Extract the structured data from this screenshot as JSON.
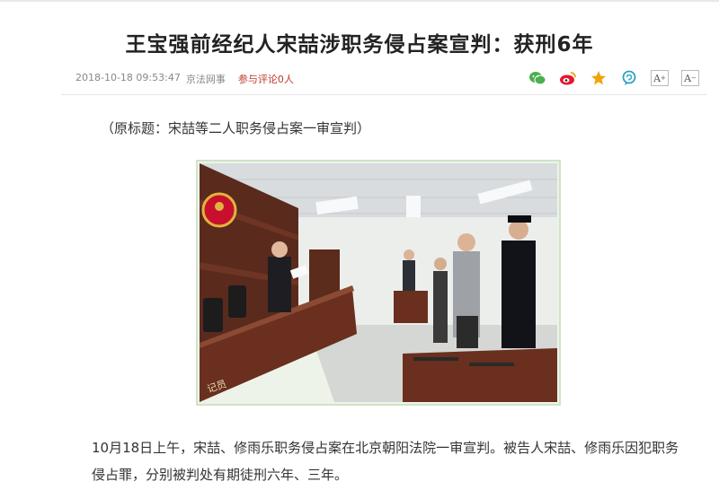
{
  "article": {
    "title": "王宝强前经纪人宋喆涉职务侵占案宣判：获刑6年",
    "date": "2018-10-18 09:53:47",
    "source": "京法网事",
    "comments": "参与评论0人",
    "subtitle": "（原标题：宋喆等二人职务侵占案一审宣判）",
    "paragraph": "10月18日上午，宋喆、修雨乐职务侵占案在北京朝阳法院一审宣判。被告人宋喆、修雨乐因犯职务侵占罪，分别被判处有期徒刑六年、三年。",
    "photo_desk_label": "记员"
  },
  "share": {
    "icons": [
      "wechat-icon",
      "weibo-icon",
      "favorite-star-icon",
      "comment-icon"
    ],
    "font_increase": "A",
    "font_decrease": "A"
  },
  "colors": {
    "accent_red": "#c0392b",
    "wechat_green": "#4caf50",
    "weibo_red": "#e6162d",
    "star_gold": "#f0a30a",
    "comment_teal": "#2aa0c8"
  }
}
